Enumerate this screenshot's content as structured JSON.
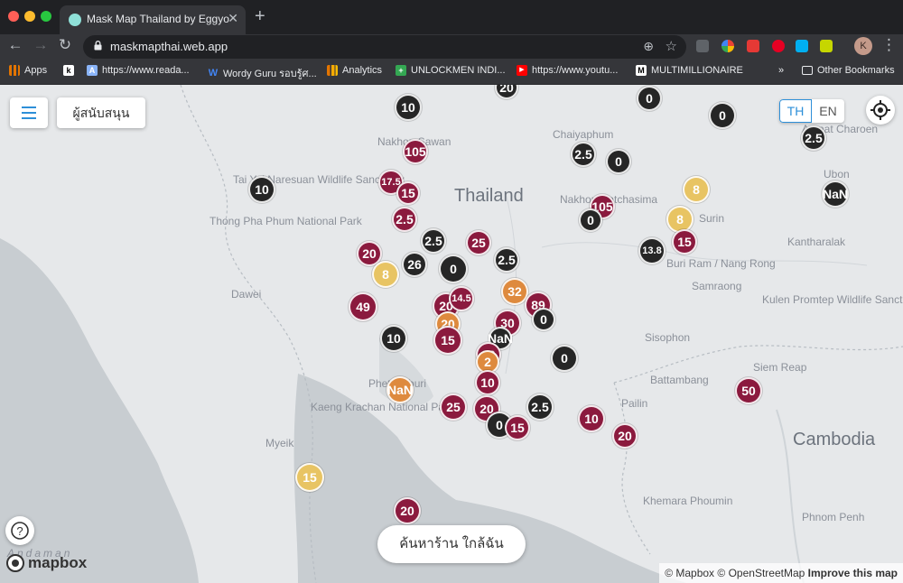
{
  "browser": {
    "tab_title": "Mask Map Thailand by Eggyo",
    "tab_close": "✕",
    "new_tab": "+",
    "url": "maskmapthai.web.app",
    "profile_initial": "K",
    "bookmarks": [
      {
        "label": "Apps",
        "icon": "apps-grid-icon",
        "color": "#e37400"
      },
      {
        "label": "",
        "icon": "kickstarter-icon",
        "color": "#ffffff"
      },
      {
        "label": "https://www.reada...",
        "icon": "readable-icon",
        "color": "#8ab4f8"
      },
      {
        "label": "Wordy Guru รอบรู้ศ...",
        "icon": "wordy-w-icon",
        "color": "#4285f4"
      },
      {
        "label": "Analytics",
        "icon": "analytics-bars-icon",
        "color": "#f9ab00"
      },
      {
        "label": "UNLOCKMEN INDI...",
        "icon": "unlockmen-icon",
        "color": "#34a853"
      },
      {
        "label": "https://www.youtu...",
        "icon": "youtube-icon",
        "color": "#ff0000"
      },
      {
        "label": "MULTIMILLIONAIRE",
        "icon": "multimillionaire-m-icon",
        "color": "#ffffff"
      }
    ],
    "bookmarks_overflow": "»",
    "other_bookmarks": "Other Bookmarks"
  },
  "map": {
    "menu_label": "",
    "supporters_button": "ผู้สนับสนุน",
    "lang_th": "TH",
    "lang_en": "EN",
    "search_nearby_button": "ค้นหาร้าน ใกล้ฉัน",
    "mapbox_logo": "mapbox",
    "attribution": {
      "mapbox": "© Mapbox",
      "osm": "© OpenStreetMap",
      "improve": "Improve this map"
    },
    "places": [
      {
        "name": "Thailand",
        "big": true
      },
      {
        "name": "Cambodia",
        "big": true
      },
      {
        "name": "Nakhon Sawan"
      },
      {
        "name": "Chaiyaphum"
      },
      {
        "name": "Amnat Charoen"
      },
      {
        "name": "Ubon"
      },
      {
        "name": "Tai Yai Naresuan Wildlife Sanctuary"
      },
      {
        "name": "Thong Pha Phum National Park"
      },
      {
        "name": "Nakhon Ratchasima"
      },
      {
        "name": "Surin"
      },
      {
        "name": "Kantharalak"
      },
      {
        "name": "Buri Ram / Nang Rong"
      },
      {
        "name": "Dawei"
      },
      {
        "name": "Samraong"
      },
      {
        "name": "Kulen Promtep Wildlife Sanctuary"
      },
      {
        "name": "Sisophon"
      },
      {
        "name": "Siem Reap"
      },
      {
        "name": "Battambang"
      },
      {
        "name": "Pailin"
      },
      {
        "name": "Phetchaburi"
      },
      {
        "name": "Kaeng Krachan National Park"
      },
      {
        "name": "Myeik"
      },
      {
        "name": "Khemara Phoumin"
      },
      {
        "name": "Phnom Penh"
      },
      {
        "name": "Andaman"
      }
    ],
    "legend_colors": {
      "black": "#262626",
      "maroon": "#8b1a3e",
      "yellow": "#e8c463",
      "orange": "#de8a3e",
      "blue": "#46bde9"
    },
    "clusters": [
      {
        "label": "20",
        "color": "black"
      },
      {
        "label": "10",
        "color": "black"
      },
      {
        "label": "0",
        "color": "black"
      },
      {
        "label": "0",
        "color": "black"
      },
      {
        "label": "2.5",
        "color": "black"
      },
      {
        "label": "105",
        "color": "maroon"
      },
      {
        "label": "2.5",
        "color": "black"
      },
      {
        "label": "0",
        "color": "black"
      },
      {
        "label": "17.5",
        "color": "maroon"
      },
      {
        "label": "15",
        "color": "maroon"
      },
      {
        "label": "10",
        "color": "black"
      },
      {
        "label": "8",
        "color": "yellow"
      },
      {
        "label": "NaN",
        "color": "black"
      },
      {
        "label": "2.5",
        "color": "maroon"
      },
      {
        "label": "105",
        "color": "maroon"
      },
      {
        "label": "0",
        "color": "black"
      },
      {
        "label": "8",
        "color": "yellow"
      },
      {
        "label": "2.5",
        "color": "black"
      },
      {
        "label": "25",
        "color": "maroon"
      },
      {
        "label": "15",
        "color": "maroon"
      },
      {
        "label": "13.8",
        "color": "black"
      },
      {
        "label": "20",
        "color": "maroon"
      },
      {
        "label": "26",
        "color": "black"
      },
      {
        "label": "0",
        "color": "black"
      },
      {
        "label": "2.5",
        "color": "black"
      },
      {
        "label": "8",
        "color": "yellow"
      },
      {
        "label": "20",
        "color": "maroon"
      },
      {
        "label": "49",
        "color": "maroon"
      },
      {
        "label": "32",
        "color": "orange"
      },
      {
        "label": "14.5",
        "color": "maroon"
      },
      {
        "label": "89",
        "color": "maroon"
      },
      {
        "label": "0",
        "color": "black"
      },
      {
        "label": "20",
        "color": "orange"
      },
      {
        "label": "30",
        "color": "maroon"
      },
      {
        "label": "10",
        "color": "black"
      },
      {
        "label": "15",
        "color": "maroon"
      },
      {
        "label": "NaN",
        "color": "black"
      },
      {
        "label": "0",
        "color": "black"
      },
      {
        "label": "20",
        "color": "maroon"
      },
      {
        "label": "2",
        "color": "orange"
      },
      {
        "label": "10",
        "color": "maroon"
      },
      {
        "label": "NaN",
        "color": "orange"
      },
      {
        "label": "50",
        "color": "maroon"
      },
      {
        "label": "25",
        "color": "maroon"
      },
      {
        "label": "20",
        "color": "maroon"
      },
      {
        "label": "2.5",
        "color": "black"
      },
      {
        "label": "0",
        "color": "black"
      },
      {
        "label": "15",
        "color": "maroon"
      },
      {
        "label": "10",
        "color": "maroon"
      },
      {
        "label": "20",
        "color": "maroon"
      },
      {
        "label": "15",
        "color": "yellow"
      },
      {
        "label": "20",
        "color": "maroon"
      }
    ]
  }
}
